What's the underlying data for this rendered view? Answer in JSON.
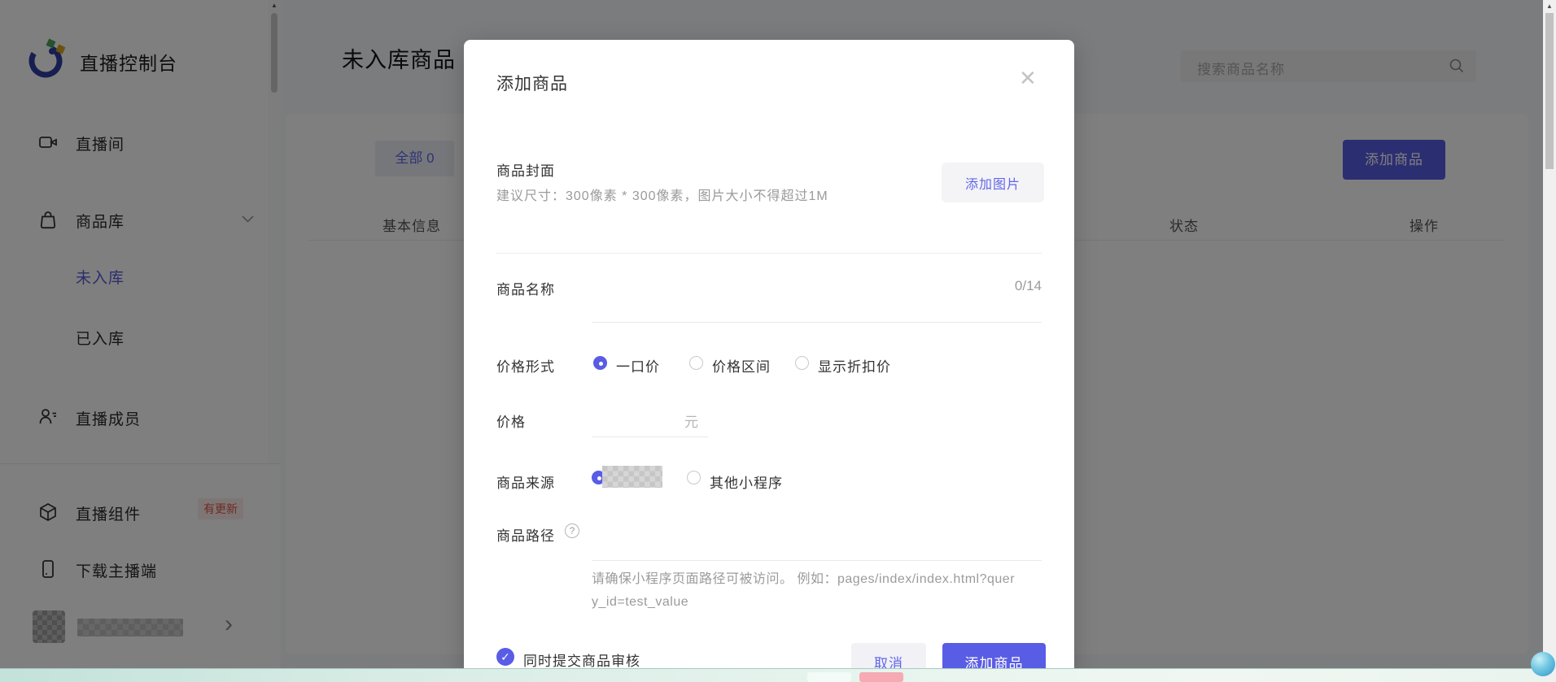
{
  "app": {
    "title": "直播控制台"
  },
  "sidebar": {
    "items": [
      {
        "label": "直播间"
      },
      {
        "label": "商品库"
      },
      {
        "label": "未入库"
      },
      {
        "label": "已入库"
      },
      {
        "label": "直播成员"
      },
      {
        "label": "直播组件",
        "badge": "有更新"
      },
      {
        "label": "下载主播端"
      }
    ]
  },
  "page": {
    "title": "未入库商品",
    "search_placeholder": "搜索商品名称",
    "tab_all": "全部 0",
    "add_product_button": "添加商品",
    "table_headers": [
      "基本信息",
      "状态",
      "操作"
    ]
  },
  "modal": {
    "title": "添加商品",
    "cover": {
      "label": "商品封面",
      "hint": "建议尺寸：300像素 * 300像素，图片大小不得超过1M",
      "button": "添加图片"
    },
    "name": {
      "label": "商品名称",
      "counter": "0/14"
    },
    "price_type": {
      "label": "价格形式",
      "options": [
        "一口价",
        "价格区间",
        "显示折扣价"
      ],
      "selected": "一口价"
    },
    "price": {
      "label": "价格",
      "unit": "元"
    },
    "source": {
      "label": "商品来源",
      "option_other": "其他小程序"
    },
    "path": {
      "label": "商品路径",
      "helper": "请确保小程序页面路径可被访问。 例如：pages/index/index.html?query_id=test_value"
    },
    "review_checkbox": {
      "label": "同时提交商品审核",
      "checked": true,
      "checkmark": "✓"
    },
    "cancel_button": "取消",
    "submit_button": "添加商品",
    "close_glyph": "✕"
  },
  "colors": {
    "accent": "#595ce5",
    "active_nav": "#595cdb",
    "badge_text": "#df5549",
    "badge_bg": "#fdecea"
  }
}
